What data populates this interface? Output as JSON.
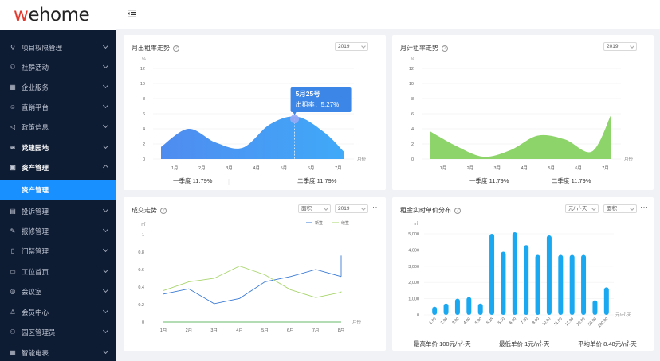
{
  "logo": {
    "prefix": "w",
    "rest": "ehome"
  },
  "menu": [
    {
      "label": "项目权限管理",
      "icon": "key-icon",
      "glyph": "⚲"
    },
    {
      "label": "社群活动",
      "icon": "people-icon",
      "glyph": "⚇"
    },
    {
      "label": "企业服务",
      "icon": "building-icon",
      "glyph": "▦"
    },
    {
      "label": "直销平台",
      "icon": "user-icon",
      "glyph": "☺"
    },
    {
      "label": "政策信息",
      "icon": "megaphone-icon",
      "glyph": "◁"
    },
    {
      "label": "党建园地",
      "icon": "wifi-icon",
      "glyph": "≋"
    },
    {
      "label": "资产管理",
      "icon": "asset-icon",
      "glyph": "▣"
    },
    {
      "label": "资产管理",
      "icon": "",
      "glyph": ""
    },
    {
      "label": "投诉管理",
      "icon": "complaint-icon",
      "glyph": "▤"
    },
    {
      "label": "报修管理",
      "icon": "wrench-icon",
      "glyph": "✎"
    },
    {
      "label": "门禁管理",
      "icon": "door-icon",
      "glyph": "▯"
    },
    {
      "label": "工位首页",
      "icon": "desk-icon",
      "glyph": "▭"
    },
    {
      "label": "会议室",
      "icon": "meeting-icon",
      "glyph": "◎"
    },
    {
      "label": "会员中心",
      "icon": "member-icon",
      "glyph": "♙"
    },
    {
      "label": "园区管理员",
      "icon": "admin-icon",
      "glyph": "⚇"
    },
    {
      "label": "智能电表",
      "icon": "meter-icon",
      "glyph": "▦"
    }
  ],
  "colors": {
    "sidebar": "#0d1b33",
    "accent": "#1890ff",
    "blue_area": "#3c88f0",
    "green_area": "#8dd46a",
    "bar": "#1aa8f0"
  },
  "card1": {
    "title": "月出租率走势",
    "year": "2019",
    "more": "···",
    "unit": "%",
    "xunit": "月份",
    "yticks": [
      "12",
      "10",
      "8",
      "6",
      "4",
      "2",
      "0"
    ],
    "months": [
      "1月",
      "2月",
      "3月",
      "4月",
      "5月",
      "6月",
      "7月"
    ],
    "tooltip": {
      "title": "5月25号",
      "text": "出租率：5.27%"
    },
    "footer_left": "一季度 11.79%",
    "footer_right": "二季度 11.79%"
  },
  "card2": {
    "title": "月计租率走势",
    "year": "2019",
    "more": "···",
    "unit": "%",
    "xunit": "月份",
    "yticks": [
      "12",
      "10",
      "8",
      "6",
      "4",
      "2",
      "0"
    ],
    "months": [
      "1月",
      "2月",
      "3月",
      "4月",
      "5月",
      "6月",
      "7月"
    ],
    "footer_left": "一季度 11.79%",
    "footer_right": "二季度 11.79%"
  },
  "card3": {
    "title": "成交走势",
    "select1": "面积",
    "year": "2019",
    "more": "···",
    "unit": "㎡",
    "xunit": "月份",
    "legend": [
      "新签",
      "续签"
    ],
    "yticks": [
      "1",
      "0.8",
      "0.6",
      "0.4",
      "0.2",
      "0"
    ],
    "months": [
      "1月",
      "2月",
      "3月",
      "4月",
      "5月",
      "6月",
      "7月",
      "8月"
    ]
  },
  "card4": {
    "title": "租金实时单价分布",
    "select1": "元/㎡·天",
    "select2": "面积",
    "more": "···",
    "unit": "㎡",
    "xunit": "元/㎡·天",
    "yticks": [
      "5,000",
      "4,000",
      "3,000",
      "2,000",
      "1,000",
      "0"
    ],
    "footer": [
      "最高单价 100元/㎡·天",
      "最低单价 1元/㎡·天",
      "平均单价 8.48元/㎡·天"
    ]
  },
  "chart_data": [
    {
      "type": "area",
      "title": "月出租率走势",
      "categories": [
        "1月",
        "2月",
        "3月",
        "4月",
        "5月",
        "6月",
        "7月"
      ],
      "x": [
        0.5,
        1.5,
        2.5,
        3.5,
        4.5,
        5.5,
        6.5,
        7.2
      ],
      "values": [
        1.6,
        4,
        2.2,
        1.5,
        4.6,
        5.6,
        3.5,
        1.0
      ],
      "ylim": [
        0,
        12
      ],
      "ylabel": "%",
      "xlabel": "月份"
    },
    {
      "type": "area",
      "title": "月计租率走势",
      "categories": [
        "1月",
        "2月",
        "3月",
        "4月",
        "5月",
        "6月",
        "7月"
      ],
      "x": [
        0.5,
        1.5,
        2.5,
        3.5,
        4.5,
        5.5,
        6.5,
        7.2
      ],
      "values": [
        3.7,
        1.7,
        0.3,
        1.2,
        3.1,
        2.6,
        1.0,
        5.8
      ],
      "ylim": [
        0,
        12
      ],
      "ylabel": "%",
      "xlabel": "月份"
    },
    {
      "type": "line",
      "title": "成交走势",
      "categories": [
        "1月",
        "2月",
        "3月",
        "4月",
        "5月",
        "6月",
        "7月",
        "8月"
      ],
      "series": [
        {
          "name": "新签",
          "values": [
            0.32,
            0.38,
            0.21,
            0.27,
            0.46,
            0.52,
            0.6,
            0.52
          ]
        },
        {
          "name": "续签",
          "values": [
            0.36,
            0.46,
            0.5,
            0.64,
            0.54,
            0.37,
            0.28,
            0.34
          ]
        },
        {
          "name": "",
          "values": [
            0,
            0,
            0,
            0,
            0,
            0,
            0,
            0
          ]
        }
      ],
      "ylim": [
        0,
        1
      ],
      "ylabel": "㎡",
      "xlabel": "月份"
    },
    {
      "type": "bar",
      "title": "租金实时单价分布",
      "categories": [
        "1.00",
        "2.00",
        "3.00",
        "4.00",
        "5.00",
        "5.25",
        "5.50",
        "6.00",
        "7.00",
        "8.00",
        "10.00",
        "11.00",
        "12.00",
        "20.00",
        "50.00",
        "100.00"
      ],
      "values": [
        500,
        700,
        1000,
        1100,
        700,
        5000,
        3900,
        5100,
        4300,
        3700,
        4900,
        3700,
        3700,
        3700,
        900,
        1700
      ],
      "ylim": [
        0,
        5000
      ],
      "ylabel": "㎡",
      "xlabel": "元/㎡·天"
    }
  ]
}
